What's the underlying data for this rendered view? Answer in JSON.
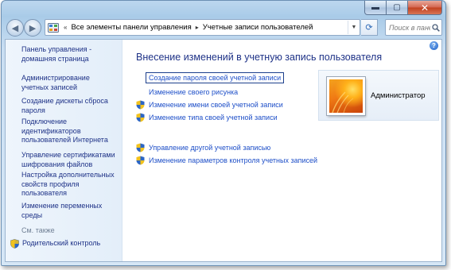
{
  "window": {
    "caption": {
      "minimize": "▬",
      "maximize": "▢",
      "close": "✕"
    }
  },
  "nav": {
    "back": "◀",
    "forward": "▶",
    "address": {
      "chevron": "«",
      "segments": [
        "Все элементы панели управления",
        "Учетные записи пользователей"
      ],
      "separator": "▸",
      "dropdown": "▼"
    },
    "refresh": "⟳",
    "search_placeholder": "Поиск в пане"
  },
  "sidebar": {
    "items": [
      {
        "label": "Панель управления - домашняя страница"
      },
      {
        "label": "Администрирование учетных записей"
      },
      {
        "label": "Создание дискеты сброса пароля"
      },
      {
        "label": "Подключение идентификаторов пользователей Интернета"
      },
      {
        "label": "Управление сертификатами шифрования файлов"
      },
      {
        "label": "Настройка дополнительных свойств профиля пользователя"
      },
      {
        "label": "Изменение переменных среды"
      }
    ],
    "see_also": "См. также",
    "parental_control": "Родительский контроль"
  },
  "main": {
    "help": "?",
    "heading": "Внесение изменений в учетную запись пользователя",
    "links": [
      {
        "label": "Создание пароля своей учетной записи",
        "shield": false
      },
      {
        "label": "Изменение своего рисунка",
        "shield": false
      },
      {
        "label": "Изменение имени своей учетной записи",
        "shield": true
      },
      {
        "label": "Изменение типа своей учетной записи",
        "shield": true
      },
      {
        "label": "Управление другой учетной записью",
        "shield": true
      },
      {
        "label": "Изменение параметров контроля учетных записей",
        "shield": true
      }
    ],
    "user": {
      "name": "Администратор"
    }
  },
  "colors": {
    "link": "#1e4fc8",
    "heading": "#1e3287",
    "chrome": "#a9cbe8"
  }
}
